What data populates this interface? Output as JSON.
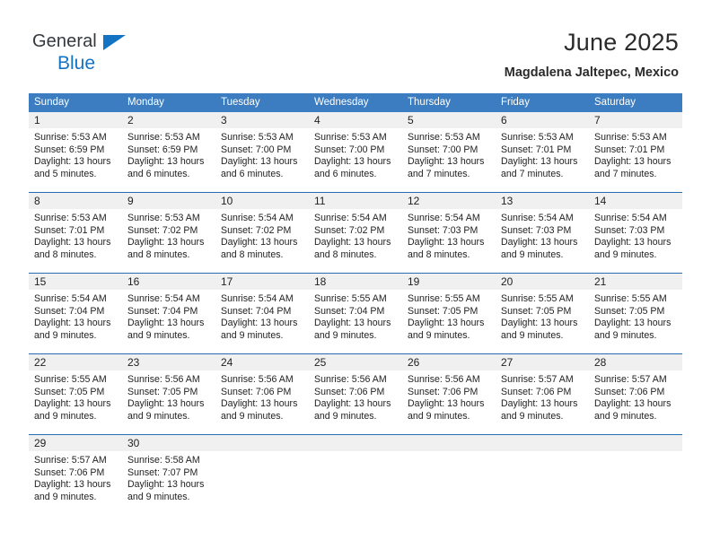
{
  "brand": {
    "name_line1": "General",
    "name_line2": "Blue",
    "accent_color": "#1374c4"
  },
  "header": {
    "title": "June 2025",
    "subtitle": "Magdalena Jaltepec, Mexico"
  },
  "theme": {
    "header_row_bg": "#3b7dc0",
    "row_divider": "#2a6cb0",
    "day_band_bg": "#f0f0f0",
    "text": "#222222"
  },
  "weekdays": [
    "Sunday",
    "Monday",
    "Tuesday",
    "Wednesday",
    "Thursday",
    "Friday",
    "Saturday"
  ],
  "weeks": [
    {
      "days": [
        {
          "date": "1",
          "lines": [
            "Sunrise: 5:53 AM",
            "Sunset: 6:59 PM",
            "Daylight: 13 hours",
            "and 5 minutes."
          ]
        },
        {
          "date": "2",
          "lines": [
            "Sunrise: 5:53 AM",
            "Sunset: 6:59 PM",
            "Daylight: 13 hours",
            "and 6 minutes."
          ]
        },
        {
          "date": "3",
          "lines": [
            "Sunrise: 5:53 AM",
            "Sunset: 7:00 PM",
            "Daylight: 13 hours",
            "and 6 minutes."
          ]
        },
        {
          "date": "4",
          "lines": [
            "Sunrise: 5:53 AM",
            "Sunset: 7:00 PM",
            "Daylight: 13 hours",
            "and 6 minutes."
          ]
        },
        {
          "date": "5",
          "lines": [
            "Sunrise: 5:53 AM",
            "Sunset: 7:00 PM",
            "Daylight: 13 hours",
            "and 7 minutes."
          ]
        },
        {
          "date": "6",
          "lines": [
            "Sunrise: 5:53 AM",
            "Sunset: 7:01 PM",
            "Daylight: 13 hours",
            "and 7 minutes."
          ]
        },
        {
          "date": "7",
          "lines": [
            "Sunrise: 5:53 AM",
            "Sunset: 7:01 PM",
            "Daylight: 13 hours",
            "and 7 minutes."
          ]
        }
      ]
    },
    {
      "days": [
        {
          "date": "8",
          "lines": [
            "Sunrise: 5:53 AM",
            "Sunset: 7:01 PM",
            "Daylight: 13 hours",
            "and 8 minutes."
          ]
        },
        {
          "date": "9",
          "lines": [
            "Sunrise: 5:53 AM",
            "Sunset: 7:02 PM",
            "Daylight: 13 hours",
            "and 8 minutes."
          ]
        },
        {
          "date": "10",
          "lines": [
            "Sunrise: 5:54 AM",
            "Sunset: 7:02 PM",
            "Daylight: 13 hours",
            "and 8 minutes."
          ]
        },
        {
          "date": "11",
          "lines": [
            "Sunrise: 5:54 AM",
            "Sunset: 7:02 PM",
            "Daylight: 13 hours",
            "and 8 minutes."
          ]
        },
        {
          "date": "12",
          "lines": [
            "Sunrise: 5:54 AM",
            "Sunset: 7:03 PM",
            "Daylight: 13 hours",
            "and 8 minutes."
          ]
        },
        {
          "date": "13",
          "lines": [
            "Sunrise: 5:54 AM",
            "Sunset: 7:03 PM",
            "Daylight: 13 hours",
            "and 9 minutes."
          ]
        },
        {
          "date": "14",
          "lines": [
            "Sunrise: 5:54 AM",
            "Sunset: 7:03 PM",
            "Daylight: 13 hours",
            "and 9 minutes."
          ]
        }
      ]
    },
    {
      "days": [
        {
          "date": "15",
          "lines": [
            "Sunrise: 5:54 AM",
            "Sunset: 7:04 PM",
            "Daylight: 13 hours",
            "and 9 minutes."
          ]
        },
        {
          "date": "16",
          "lines": [
            "Sunrise: 5:54 AM",
            "Sunset: 7:04 PM",
            "Daylight: 13 hours",
            "and 9 minutes."
          ]
        },
        {
          "date": "17",
          "lines": [
            "Sunrise: 5:54 AM",
            "Sunset: 7:04 PM",
            "Daylight: 13 hours",
            "and 9 minutes."
          ]
        },
        {
          "date": "18",
          "lines": [
            "Sunrise: 5:55 AM",
            "Sunset: 7:04 PM",
            "Daylight: 13 hours",
            "and 9 minutes."
          ]
        },
        {
          "date": "19",
          "lines": [
            "Sunrise: 5:55 AM",
            "Sunset: 7:05 PM",
            "Daylight: 13 hours",
            "and 9 minutes."
          ]
        },
        {
          "date": "20",
          "lines": [
            "Sunrise: 5:55 AM",
            "Sunset: 7:05 PM",
            "Daylight: 13 hours",
            "and 9 minutes."
          ]
        },
        {
          "date": "21",
          "lines": [
            "Sunrise: 5:55 AM",
            "Sunset: 7:05 PM",
            "Daylight: 13 hours",
            "and 9 minutes."
          ]
        }
      ]
    },
    {
      "days": [
        {
          "date": "22",
          "lines": [
            "Sunrise: 5:55 AM",
            "Sunset: 7:05 PM",
            "Daylight: 13 hours",
            "and 9 minutes."
          ]
        },
        {
          "date": "23",
          "lines": [
            "Sunrise: 5:56 AM",
            "Sunset: 7:05 PM",
            "Daylight: 13 hours",
            "and 9 minutes."
          ]
        },
        {
          "date": "24",
          "lines": [
            "Sunrise: 5:56 AM",
            "Sunset: 7:06 PM",
            "Daylight: 13 hours",
            "and 9 minutes."
          ]
        },
        {
          "date": "25",
          "lines": [
            "Sunrise: 5:56 AM",
            "Sunset: 7:06 PM",
            "Daylight: 13 hours",
            "and 9 minutes."
          ]
        },
        {
          "date": "26",
          "lines": [
            "Sunrise: 5:56 AM",
            "Sunset: 7:06 PM",
            "Daylight: 13 hours",
            "and 9 minutes."
          ]
        },
        {
          "date": "27",
          "lines": [
            "Sunrise: 5:57 AM",
            "Sunset: 7:06 PM",
            "Daylight: 13 hours",
            "and 9 minutes."
          ]
        },
        {
          "date": "28",
          "lines": [
            "Sunrise: 5:57 AM",
            "Sunset: 7:06 PM",
            "Daylight: 13 hours",
            "and 9 minutes."
          ]
        }
      ]
    },
    {
      "days": [
        {
          "date": "29",
          "lines": [
            "Sunrise: 5:57 AM",
            "Sunset: 7:06 PM",
            "Daylight: 13 hours",
            "and 9 minutes."
          ]
        },
        {
          "date": "30",
          "lines": [
            "Sunrise: 5:58 AM",
            "Sunset: 7:07 PM",
            "Daylight: 13 hours",
            "and 9 minutes."
          ]
        },
        {
          "date": "",
          "lines": []
        },
        {
          "date": "",
          "lines": []
        },
        {
          "date": "",
          "lines": []
        },
        {
          "date": "",
          "lines": []
        },
        {
          "date": "",
          "lines": []
        }
      ]
    }
  ]
}
